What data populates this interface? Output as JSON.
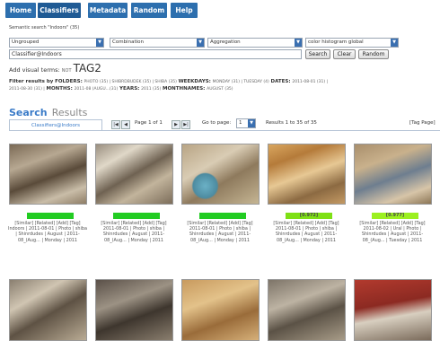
{
  "nav": {
    "items": [
      "Home",
      "Classifiers",
      "Metadata",
      "Random",
      "Help"
    ]
  },
  "search_caption": "Semantic search \"Indoors\" (35)",
  "controls": {
    "group_select": "Ungrouped",
    "combination_select": "Combination",
    "aggregation_select": "Aggregation",
    "histogram_select": "color histogram global",
    "query_value": "Classifier@Indoors",
    "search_label": "Search",
    "clear_label": "Clear",
    "random_label": "Random"
  },
  "visual_terms": {
    "label": "Add visual terms:",
    "not_label": "NOT",
    "tag": "TAG2"
  },
  "filters": {
    "intro": "Filter results by",
    "folders_label": "FOLDERS:",
    "folders_value": "PHOTO (35) | SHIBRDBUDEK (35) | SHIBA (35)",
    "weekdays_label": "WEEKDAYS:",
    "weekdays_value": "MONDAY (31) | TUESDAY (4)",
    "dates_label": "DATES:",
    "dates_value": "2011-08-01 (31) |",
    "dates_cont": "2011-08-30 (31) |",
    "months_label": "MONTHS:",
    "months_value": "2011-08 (AUGU...(31)",
    "years_label": "YEARS:",
    "years_value": "2011 (35)",
    "monthnames_label": "MONTHNAMES:",
    "monthnames_value": "AUGUST (35)"
  },
  "results_title": {
    "part1": "Search",
    "part2": "Results"
  },
  "tab_label": "Classifiers@Indoors",
  "pager": {
    "page_text": "Page 1 of 1",
    "goto_label": "Go to page:",
    "goto_value": "1",
    "results_text": "Results 1 to 35 of 35",
    "tag_page": "[Tag Page]"
  },
  "results": [
    {
      "score": "",
      "score_color": "#22cc22",
      "links": "[Similar] [Related] [Add] [Tag]",
      "meta": "Indoors | 2011-08-01 | Photo | shiba | Shinrdudes | August | 2011-08_(Aug... | Monday | 2011"
    },
    {
      "score": "",
      "score_color": "#22cc22",
      "links": "[Similar] [Related] [Add] [Tag]",
      "meta": "2011-08-01 | Photo | shiba | Shinrdudes | August | 2011-08_(Aug... | Monday | 2011"
    },
    {
      "score": "",
      "score_color": "#22cc22",
      "links": "[Similar] [Related] [Add] [Tag]",
      "meta": "2011-08-01 | Photo | shiba | Shinrdudes | August | 2011-08_(Aug... | Monday | 2011"
    },
    {
      "score": "[0.972]",
      "score_color": "#7ee015",
      "links": "[Similar] [Related] [Add] [Tag]",
      "meta": "2011-08-01 | Photo | shiba | Shinrdudes | August | 2011-08_(Aug... | Monday | 2011"
    },
    {
      "score": "[0.977]",
      "score_color": "#9cf020",
      "links": "[Similar] [Related] [Add] [Tag]",
      "meta": "2011-08-02 | Ural | Photo | Shinrdudes | August | 2011-08_(Aug... | Tuesday | 2011"
    }
  ],
  "second_row_count": "5"
}
